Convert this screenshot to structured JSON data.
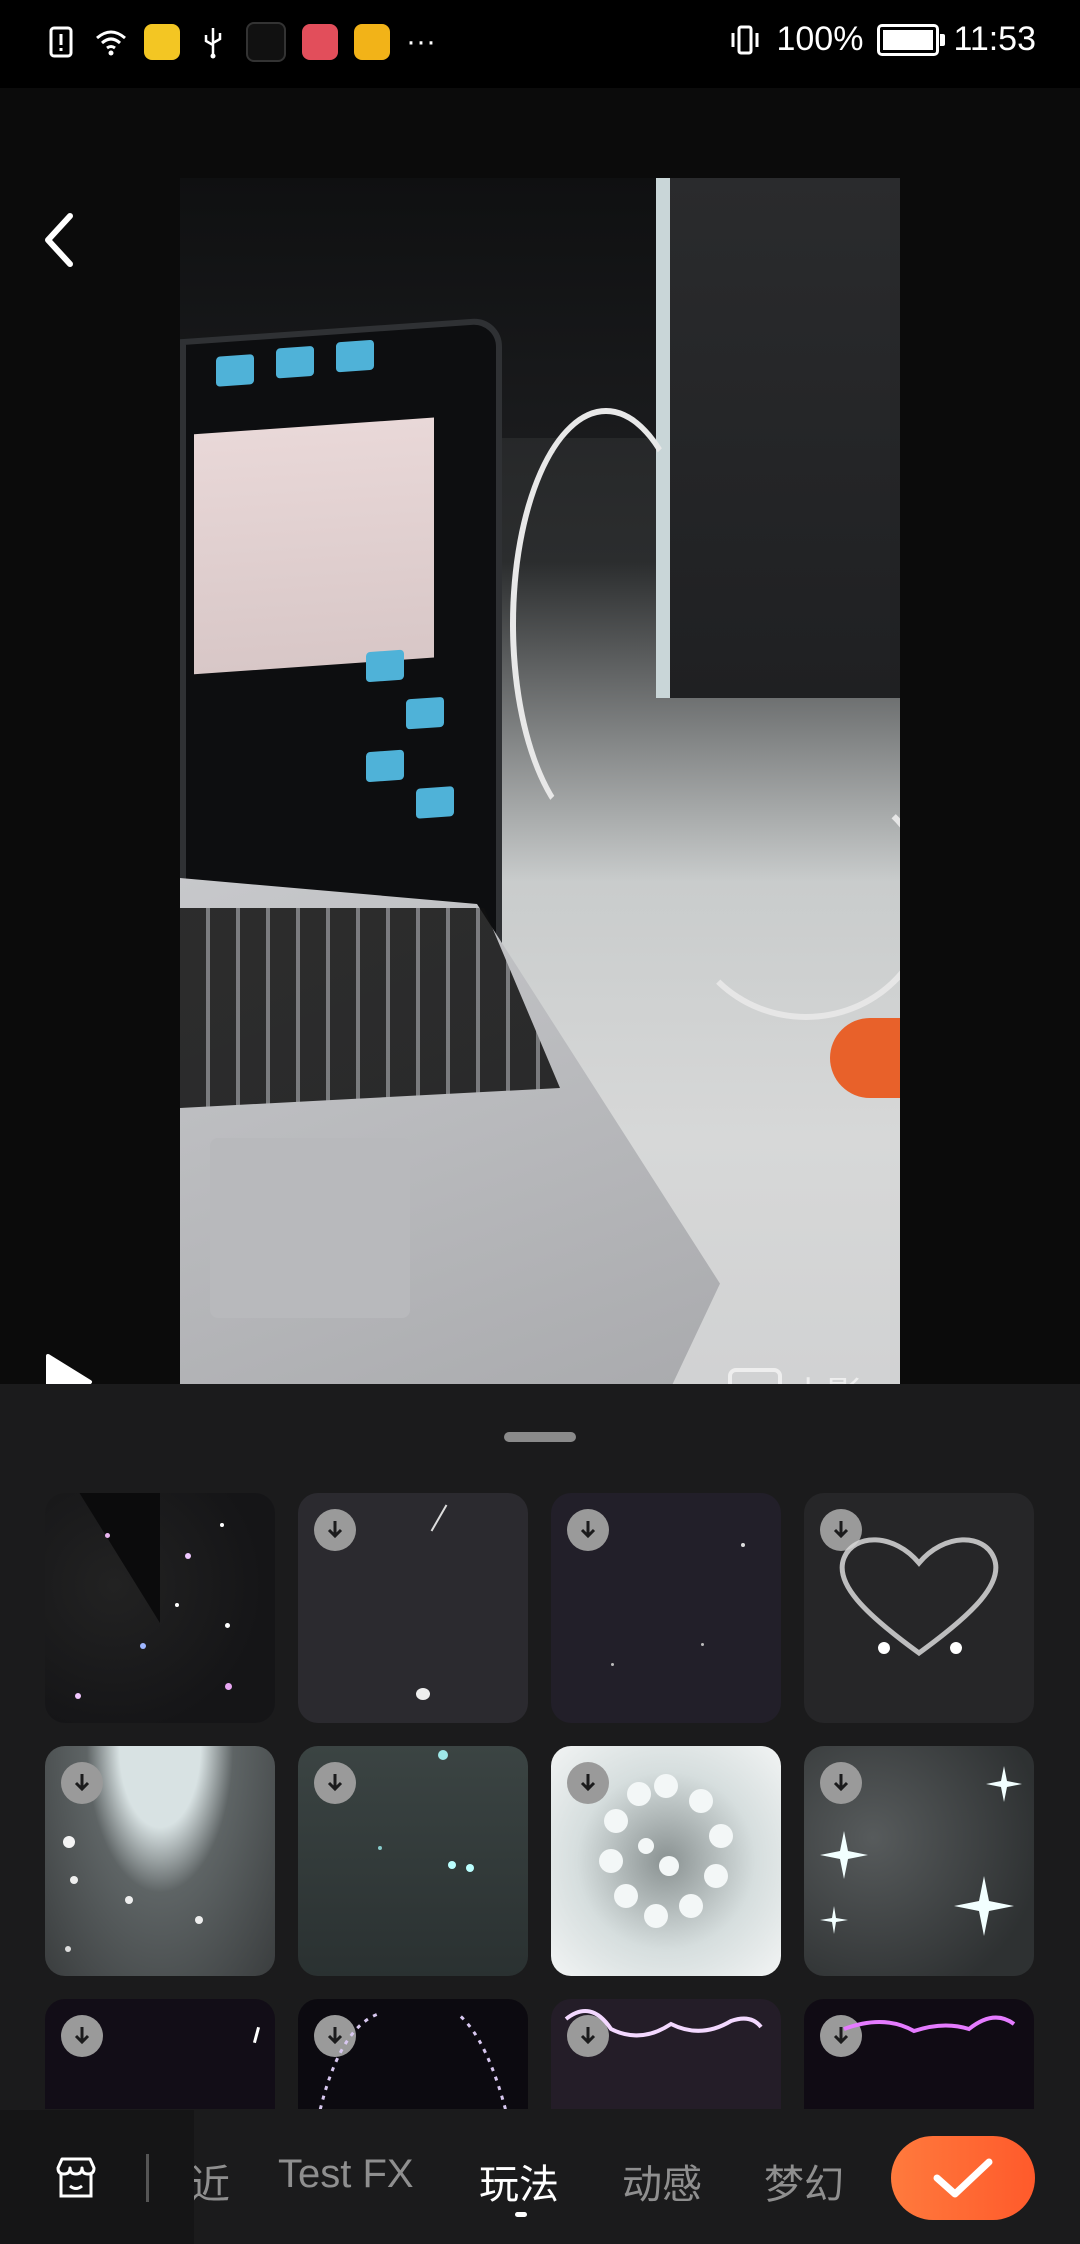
{
  "status_bar": {
    "battery": "100%",
    "time": "11:53",
    "more": "···"
  },
  "preview": {
    "watermark": "小影"
  },
  "tabs": [
    {
      "label": "近"
    },
    {
      "label": "Test FX"
    },
    {
      "label": "玩法",
      "active": true
    },
    {
      "label": "动感"
    },
    {
      "label": "梦幻"
    }
  ],
  "colors": {
    "accent": "#ff6a33",
    "panel_bg": "#1b1b1c"
  },
  "icons": [
    "back-arrow-icon",
    "play-icon",
    "download-icon",
    "store-icon",
    "check-icon"
  ]
}
